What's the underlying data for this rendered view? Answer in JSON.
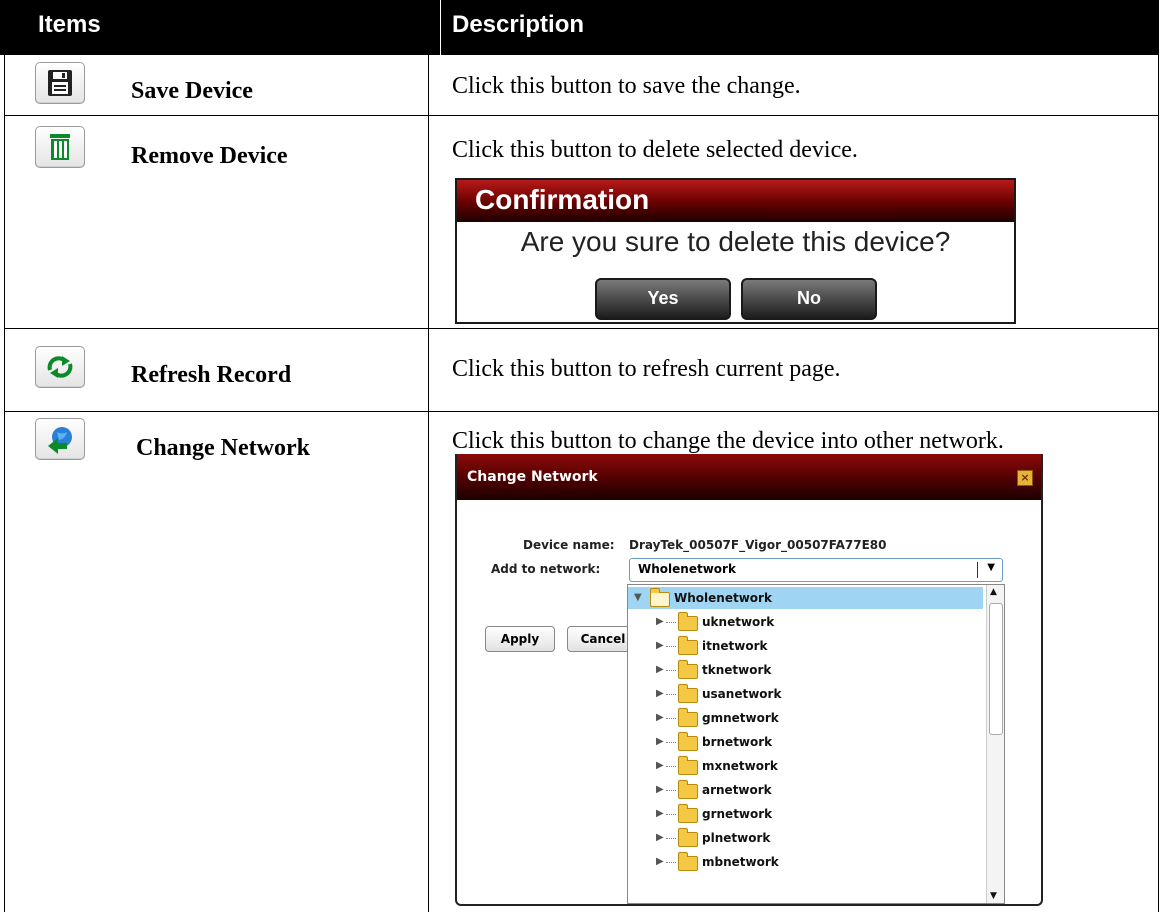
{
  "table": {
    "header": {
      "items": "Items",
      "description": "Description"
    },
    "rows": [
      {
        "label": "Save Device",
        "description": "Click this button to save the change."
      },
      {
        "label": "Remove Device",
        "description": "Click this button to delete selected device."
      },
      {
        "label": "Refresh Record",
        "description": "Click this button to refresh current page."
      },
      {
        "label": "Change Network",
        "description": "Click this button to change the device into other network."
      }
    ]
  },
  "icons": {
    "save": "floppy-disk-icon",
    "remove": "trash-icon",
    "refresh": "refresh-arrows-icon",
    "change_network": "globe-arrow-icon"
  },
  "confirm_dialog": {
    "title": "Confirmation",
    "message": "Are you sure to delete this device?",
    "yes": "Yes",
    "no": "No"
  },
  "change_network_dialog": {
    "title": "Change Network",
    "device_name_label": "Device name:",
    "device_name_value": "DrayTek_00507F_Vigor_00507FA77E80",
    "add_to_network_label": "Add to network:",
    "selected_network": "Wholenetwork",
    "apply": "Apply",
    "cancel": "Cancel",
    "tree_root": "Wholenetwork",
    "tree_children": [
      "uknetwork",
      "itnetwork",
      "tknetwork",
      "usanetwork",
      "gmnetwork",
      "brnetwork",
      "mxnetwork",
      "arnetwork",
      "grnetwork",
      "plnetwork",
      "mbnetwork"
    ]
  },
  "colors": {
    "header_bg": "#000000",
    "dialog_title_red": "#8c0a0a",
    "tree_highlight": "#9fd4f2",
    "folder": "#f4c842"
  }
}
